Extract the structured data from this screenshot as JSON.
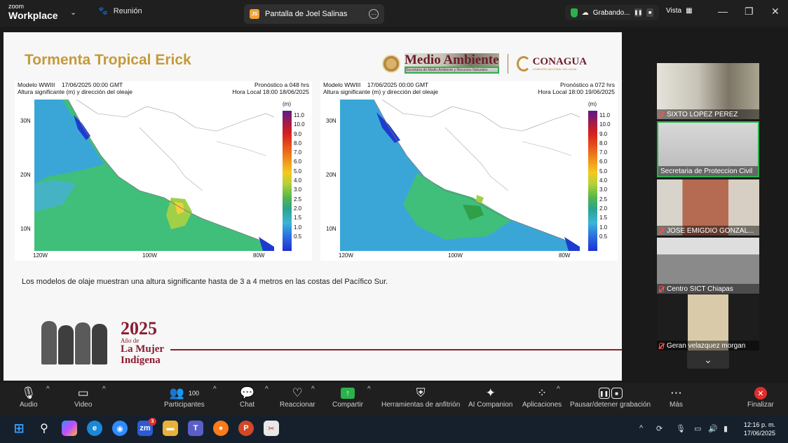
{
  "app": {
    "logo_small": "zoom",
    "logo_big": "Workplace"
  },
  "titlebar": {
    "meeting_tab": "Reunión",
    "share_tab": "Pantalla de Joel Salinas",
    "share_badge": "JS",
    "recording": "Grabando...",
    "view": "Vista"
  },
  "slide": {
    "title": "Tormenta Tropical Erick",
    "logo_main": "Medio Ambiente",
    "logo_sub": "Secretaría de Medio Ambiente y Recursos Naturales",
    "logo2_main": "CONAGUA",
    "logo2_sub": "COMISIÓN NACIONAL DEL AGUA",
    "caption": "Los modelos de olaje muestran una altura significante hasta de 3 a 4 metros en las costas del Pacífico Sur.",
    "year": "2025",
    "year_sub": "Año de",
    "year_line1": "La Mujer",
    "year_line2": "Indígena"
  },
  "maps": [
    {
      "model": "Modelo WWIII",
      "run": "17/06/2025 00:00 GMT",
      "subtitle": "Altura significante (m) y dirección del oleaje",
      "forecast": "Pronóstico a 048 hrs",
      "local": "Hora Local 18:00 18/06/2025"
    },
    {
      "model": "Modelo WWIII",
      "run": "17/06/2025 00:00 GMT",
      "subtitle": "Altura significante (m) y dirección del oleaje",
      "forecast": "Pronóstico a 072 hrs",
      "local": "Hora Local 18:00 19/06/2025"
    }
  ],
  "map_axes": {
    "lat": [
      "30N",
      "20N",
      "10N"
    ],
    "lon": [
      "120W",
      "100W",
      "80W"
    ],
    "unit": "(m)",
    "ticks": [
      "11.0",
      "10.0",
      "9.0",
      "8.0",
      "7.0",
      "6.0",
      "5.0",
      "4.0",
      "3.0",
      "2.5",
      "2.0",
      "1.5",
      "1.0",
      "0.5"
    ]
  },
  "participants": [
    {
      "name": "SIXTO LOPEZ PEREZ"
    },
    {
      "name": "Secretaria de Proteccion Civil"
    },
    {
      "name": "JOSE EMIGDIO GONZAL..."
    },
    {
      "name": "Centro SICT Chiapas"
    },
    {
      "name": "Geran velazquez morgan"
    }
  ],
  "toolbar": {
    "audio": "Audio",
    "video": "Video",
    "participants": "Participantes",
    "participants_count": "100",
    "chat": "Chat",
    "react": "Reaccionar",
    "share": "Compartir",
    "host_tools": "Herramientas de anfitrión",
    "ai": "AI Companion",
    "apps": "Aplicaciones",
    "record": "Pausar/detener grabación",
    "more": "Más",
    "end": "Finalizar"
  },
  "taskbar": {
    "time": "12:16 p. m.",
    "date": "17/06/2025",
    "zoom_badge": "3"
  }
}
